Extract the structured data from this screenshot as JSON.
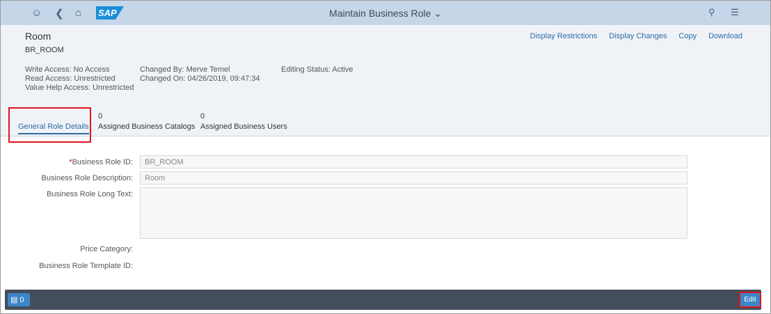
{
  "shell": {
    "title": "Maintain Business Role",
    "logo": "SAP",
    "icons": [
      "user-icon",
      "back-icon",
      "home-icon",
      "search-icon",
      "menu-icon"
    ]
  },
  "header": {
    "title": "Room",
    "subtitle": "BR_ROOM",
    "actions": [
      "Display Restrictions",
      "Display Changes",
      "Copy",
      "Download"
    ],
    "meta1": [
      "Write Access: No Access",
      "Read Access: Unrestricted",
      "Value Help Access: Unrestricted"
    ],
    "meta2": [
      "Changed By: Merve Temel",
      "Changed On: 04/26/2019, 09:47:34"
    ],
    "meta3": [
      "Editing Status: Active"
    ]
  },
  "tabs": [
    {
      "label": "General Role Details",
      "count": ""
    },
    {
      "label": "Assigned Business Catalogs",
      "count": "0"
    },
    {
      "label": "Assigned Business Users",
      "count": "0"
    }
  ],
  "form": {
    "required_mark": "*",
    "id_label": "Business Role ID:",
    "id_value": "BR_ROOM",
    "desc_label": "Business Role Description:",
    "desc_value": "Room",
    "long_label": "Business Role Long Text:",
    "long_value": "",
    "price_label": "Price Category:",
    "template_label": "Business Role Template ID:"
  },
  "footer": {
    "messages_count": "0",
    "edit_label": "Edit"
  }
}
